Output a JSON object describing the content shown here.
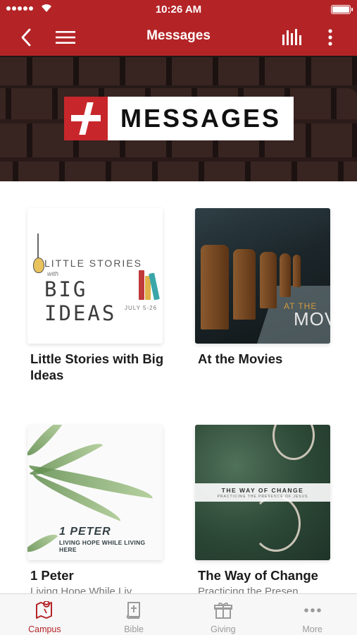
{
  "status_bar": {
    "time": "10:26 AM"
  },
  "nav": {
    "title": "Messages"
  },
  "hero": {
    "logo_text": "MESSAGES"
  },
  "series": [
    {
      "title": "Little Stories with Big Ideas",
      "subtitle": "",
      "art": {
        "line1": "LITTLE STORIES",
        "line2": "with",
        "line3": "BIG IDEAS",
        "date": "JULY 5-26"
      }
    },
    {
      "title": "At the Movies",
      "subtitle": "",
      "art": {
        "line1": "AT THE",
        "line2": "MOV"
      }
    },
    {
      "title": "1 Peter",
      "subtitle": "Living Hope While Liv...",
      "art": {
        "line1": "1 PETER",
        "line2": "LIVING HOPE WHILE LIVING HERE"
      }
    },
    {
      "title": "The Way of Change",
      "subtitle": "Practicing the Presen...",
      "art": {
        "line1": "THE WAY OF CHANGE",
        "line2": "PRACTICING THE PRESENCE OF JESUS"
      }
    }
  ],
  "tabs": [
    {
      "label": "Campus",
      "icon": "map-icon",
      "active": true
    },
    {
      "label": "Bible",
      "icon": "bible-icon",
      "active": false
    },
    {
      "label": "Giving",
      "icon": "gift-icon",
      "active": false
    },
    {
      "label": "More",
      "icon": "ellipsis-icon",
      "active": false
    }
  ],
  "colors": {
    "primary": "#b42427",
    "tab_inactive": "#9a9a9a",
    "background": "#ffffff"
  }
}
